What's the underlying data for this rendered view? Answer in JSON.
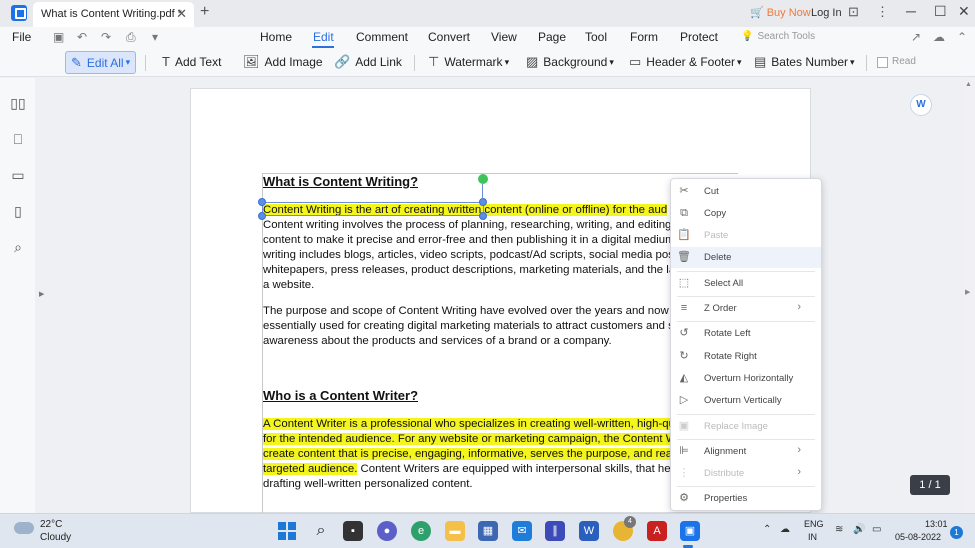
{
  "titlebar": {
    "tab_title": "What is Content Writing.pdf *",
    "tab_close": "✕",
    "new_tab": "+",
    "buy_now": "Buy Now",
    "login": "Log In"
  },
  "menubar": {
    "file": "File",
    "items": [
      "Home",
      "Edit",
      "Comment",
      "Convert",
      "View",
      "Page",
      "Tool",
      "Form",
      "Protect"
    ],
    "search_tools": "Search Tools"
  },
  "toolbar": {
    "edit_all": "Edit All",
    "add_text": "Add Text",
    "add_image": "Add Image",
    "add_link": "Add Link",
    "watermark": "Watermark",
    "background": "Background",
    "header_footer": "Header & Footer",
    "bates_number": "Bates Number",
    "read": "Read"
  },
  "document": {
    "heading1": "What is Content Writing?",
    "para1_hl": "Content Writing is the art of creating written content (online or offline) for the aud",
    "para1_lines": [
      "Content writing involves the process of planning, researching, writing, and editing",
      "content to make it precise and error-free and then publishing it in a digital medium",
      "writing includes blogs, articles, video scripts, podcast/Ad scripts, social media posts",
      "whitepapers, press releases, product descriptions, marketing materials, and the lar",
      "a website."
    ],
    "para2_lines": [
      "The purpose and scope of Content Writing have evolved over the years and now it",
      "essentially used for creating digital marketing materials to attract customers and sp",
      "awareness about the products and services of a brand or a company."
    ],
    "heading2": "Who is a Content Writer?",
    "para3_hl_lines": [
      "A Content Writer is a professional who specializes in creating well-written, high-qu",
      "for the intended audience. For any website or marketing campaign, the Content W",
      "create content that is precise, engaging, informative, serves the purpose, and reac"
    ],
    "para3_last_hl": "targeted audience.",
    "para3_last_rest": " Content Writers are equipped with interpersonal skills, that hel",
    "para3_end": "drafting well-written personalized content."
  },
  "context_menu": {
    "items": [
      {
        "label": "Cut",
        "icon": "scissors-icon",
        "glyph": "✂",
        "disabled": false,
        "submenu": false
      },
      {
        "label": "Copy",
        "icon": "copy-icon",
        "glyph": "⧉",
        "disabled": false,
        "submenu": false
      },
      {
        "label": "Paste",
        "icon": "paste-icon",
        "glyph": "📋",
        "disabled": true,
        "submenu": false
      },
      {
        "label": "Delete",
        "icon": "trash-icon",
        "glyph": "🗑",
        "disabled": false,
        "submenu": false
      },
      {
        "label": "Select All",
        "icon": "select-all-icon",
        "glyph": "⬚",
        "disabled": false,
        "submenu": false
      },
      {
        "label": "Z Order",
        "icon": "z-order-icon",
        "glyph": "≡",
        "disabled": false,
        "submenu": true
      },
      {
        "label": "Rotate Left",
        "icon": "rotate-left-icon",
        "glyph": "↺",
        "disabled": false,
        "submenu": false
      },
      {
        "label": "Rotate Right",
        "icon": "rotate-right-icon",
        "glyph": "↻",
        "disabled": false,
        "submenu": false
      },
      {
        "label": "Overturn Horizontally",
        "icon": "flip-horizontal-icon",
        "glyph": "◭",
        "disabled": false,
        "submenu": false
      },
      {
        "label": "Overturn Vertically",
        "icon": "flip-vertical-icon",
        "glyph": "▷",
        "disabled": false,
        "submenu": false
      },
      {
        "label": "Replace Image",
        "icon": "replace-image-icon",
        "glyph": "▣",
        "disabled": true,
        "submenu": false
      },
      {
        "label": "Alignment",
        "icon": "alignment-icon",
        "glyph": "⊫",
        "disabled": false,
        "submenu": true
      },
      {
        "label": "Distribute",
        "icon": "distribute-icon",
        "glyph": "⋮",
        "disabled": true,
        "submenu": true
      },
      {
        "label": "Properties",
        "icon": "properties-icon",
        "glyph": "⚙",
        "disabled": false,
        "submenu": false
      }
    ]
  },
  "page_counter": "1 / 1",
  "taskbar": {
    "temp": "22°C",
    "condition": "Cloudy",
    "lang_line1": "ENG",
    "lang_line2": "IN",
    "time": "13:01",
    "date": "05-08-2022",
    "notifications": "1",
    "badge_on_app": "4"
  },
  "colors": {
    "accent": "#2b6fe0",
    "highlight": "#f5f51e",
    "buy_now": "#f07a3a"
  }
}
